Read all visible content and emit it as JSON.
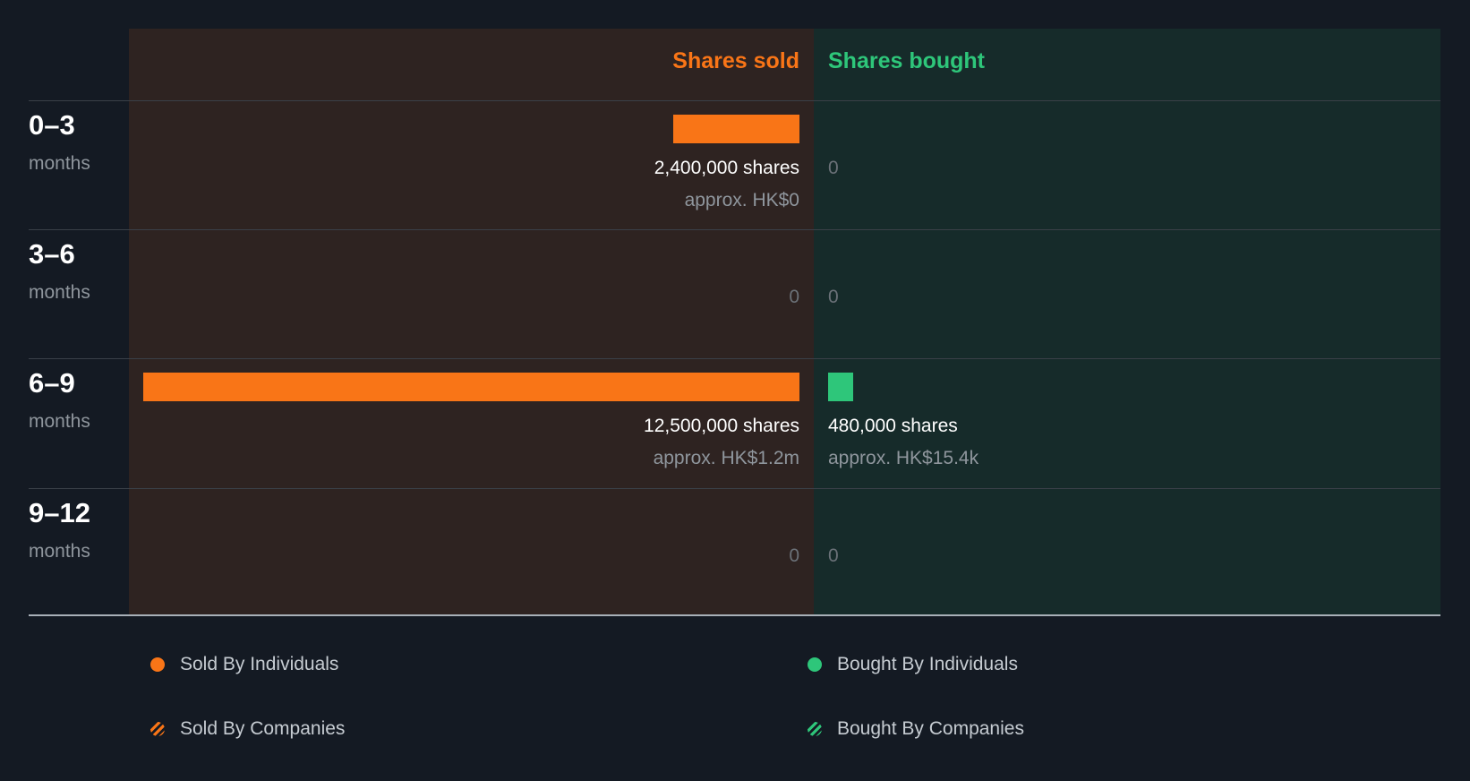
{
  "chart_data": {
    "type": "bar",
    "headers": {
      "sold": "Shares sold",
      "bought": "Shares bought"
    },
    "unit": "months",
    "periods": [
      {
        "label": "0–3",
        "sold": 2400000,
        "sold_text": "2,400,000 shares",
        "sold_value": "approx. HK$0",
        "bought": 0,
        "bought_text": "0",
        "bought_value": ""
      },
      {
        "label": "3–6",
        "sold": 0,
        "sold_text": "0",
        "sold_value": "",
        "bought": 0,
        "bought_text": "0",
        "bought_value": ""
      },
      {
        "label": "6–9",
        "sold": 12500000,
        "sold_text": "12,500,000 shares",
        "sold_value": "approx. HK$1.2m",
        "bought": 480000,
        "bought_text": "480,000 shares",
        "bought_value": "approx. HK$15.4k"
      },
      {
        "label": "9–12",
        "sold": 0,
        "sold_text": "0",
        "sold_value": "",
        "bought": 0,
        "bought_text": "0",
        "bought_value": ""
      }
    ],
    "legend": [
      {
        "label": "Sold By Individuals",
        "style": "dot",
        "color": "#f97517"
      },
      {
        "label": "Bought By Individuals",
        "style": "dot",
        "color": "#2ec67a"
      },
      {
        "label": "Sold By Companies",
        "style": "stripe",
        "color": "#f97517"
      },
      {
        "label": "Bought By Companies",
        "style": "stripe",
        "color": "#2ec67a"
      }
    ],
    "colors": {
      "sold": "#f97517",
      "bought": "#2ec67a"
    }
  }
}
